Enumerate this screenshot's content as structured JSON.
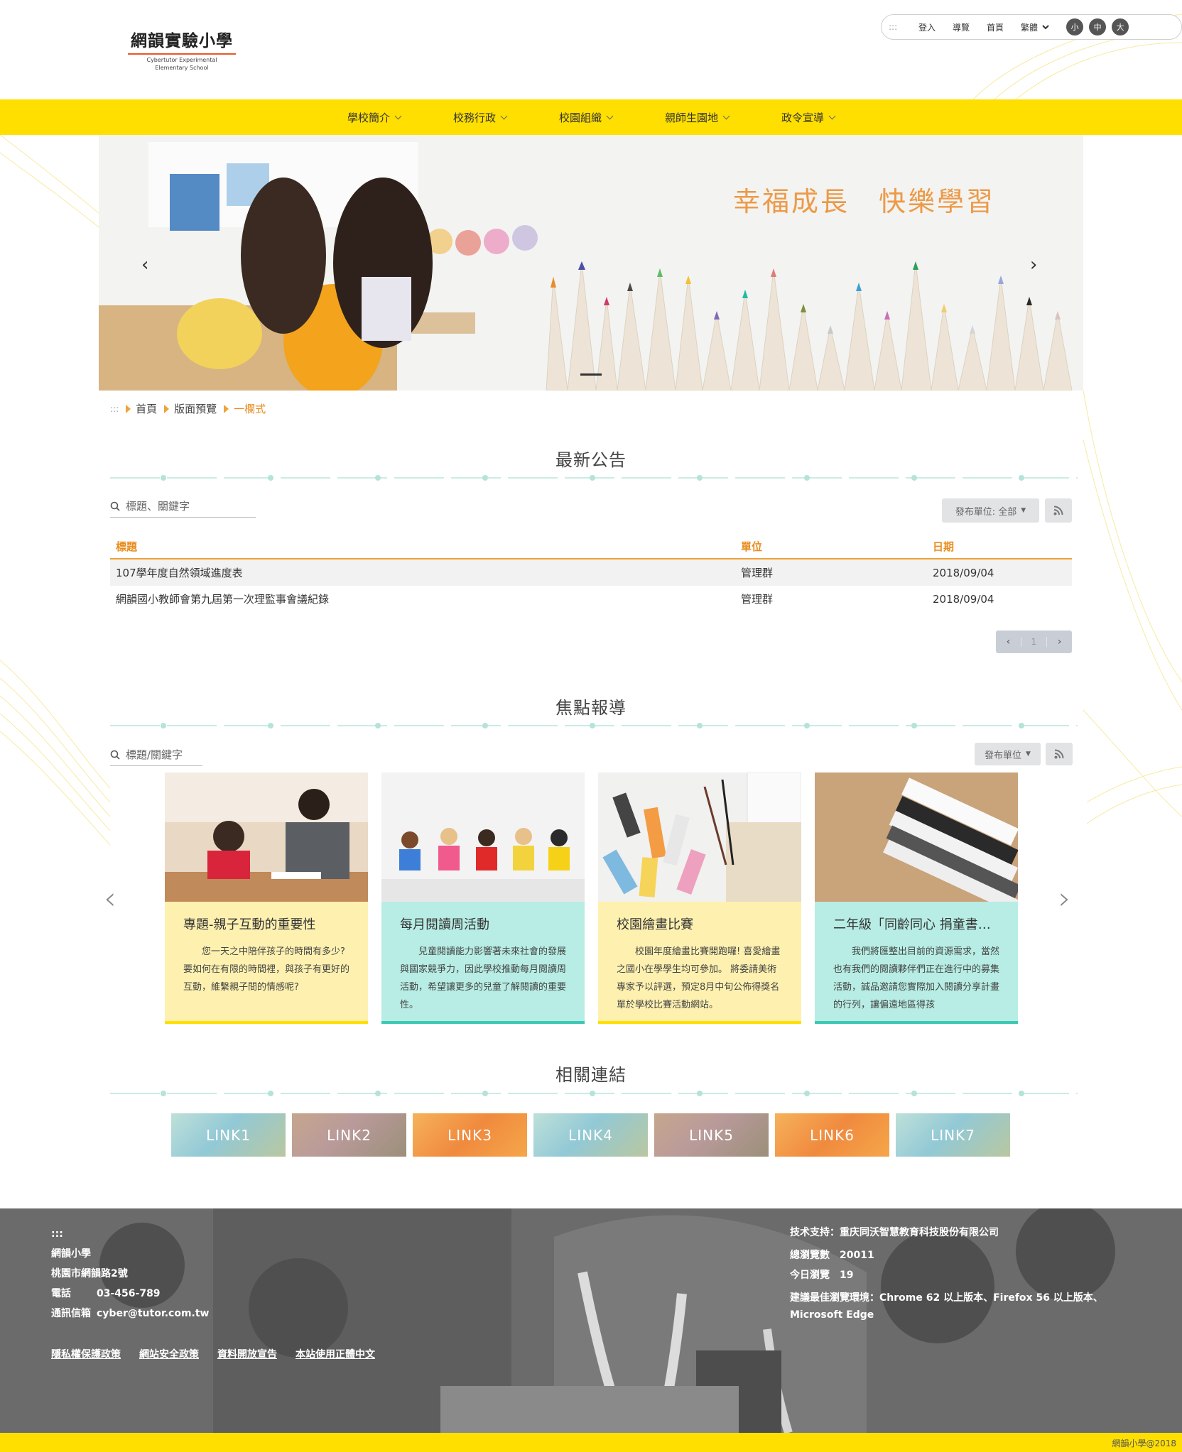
{
  "header": {
    "logo_zh": "網韻實驗小學",
    "logo_en_1": "Cybertutor Experimental",
    "logo_en_2": "Elementary School",
    "access_key": ":::",
    "login": "登入",
    "guide": "導覽",
    "home": "首頁",
    "language": "繁體",
    "font_small": "小",
    "font_medium": "中",
    "font_large": "大"
  },
  "nav": [
    "學校簡介",
    "校務行政",
    "校園組織",
    "親師生園地",
    "政令宣導"
  ],
  "banner": {
    "slogan": "幸福成長　快樂學習"
  },
  "breadcrumb": {
    "access_key": ":::",
    "home": "首頁",
    "level1": "版面預覽",
    "current": "一欄式"
  },
  "announcements": {
    "title": "最新公告",
    "search_placeholder": "標題、關鍵字",
    "unit_filter": "發布單位: 全部",
    "columns": [
      "標題",
      "單位",
      "日期"
    ],
    "rows": [
      {
        "title": "107學年度自然領域進度表",
        "unit": "管理群",
        "date": "2018/09/04"
      },
      {
        "title": "網韻國小教師會第九屆第一次理監事會議紀錄",
        "unit": "管理群",
        "date": "2018/09/04"
      }
    ],
    "page": "1"
  },
  "focus": {
    "title": "焦點報導",
    "search_placeholder": "標題/關鍵字",
    "unit_filter": "發布單位",
    "cards": [
      {
        "title": "專題-親子互動的重要性",
        "desc": "您一天之中陪伴孩子的時間有多少?要如何在有限的時間裡，與孩子有更好的互動，維繫親子間的情感呢?"
      },
      {
        "title": "每月閱讀周活動",
        "desc": "兒童閱讀能力影響著未來社會的發展與國家競爭力，因此學校推動每月閱讀周活動，希望讓更多的兒童了解閱讀的重要性。"
      },
      {
        "title": "校園繪畫比賽",
        "desc": "校園年度繪畫比賽開跑囉! 喜愛繪畫之國小在學學生均可參加。 將委請美術專家予以評選，預定8月中旬公佈得獎名單於學校比賽活動網站。"
      },
      {
        "title": "二年級「同齡同心 捐童書…",
        "desc": "我們將匯整出目前的資源需求，當然也有我們的閱讀夥伴們正在進行中的募集活動，誠品邀請您實際加入閱讀分享計畫的行列，讓偏遠地區得孩"
      }
    ]
  },
  "links": {
    "title": "相關連結",
    "items": [
      "LINK1",
      "LINK2",
      "LINK3",
      "LINK4",
      "LINK5",
      "LINK6",
      "LINK7"
    ]
  },
  "footer": {
    "access_key": ":::",
    "school": "網韻小學",
    "address": "桃園市網韻路2號",
    "phone_label": "電話",
    "phone": "03-456-789",
    "email_label": "通訊信箱",
    "email": "cyber@tutor.com.tw",
    "support": "技术支持：重庆同沃智慧教育科技股份有限公司",
    "total_views": "總瀏覽數　20011",
    "today_views": "今日瀏覽　19",
    "browser": "建議最佳瀏覽環境：Chrome 62 以上版本、Firefox 56 以上版本、Microsoft Edge",
    "policies": [
      "隱私權保護政策",
      "網站安全政策",
      "資料開放宣告",
      "本站使用正體中文"
    ],
    "copyright": "網韻小學@2018"
  },
  "colors": {
    "nav_yellow": "#ffdf00",
    "accent_orange": "#e98c1e",
    "card_yellow": "#fef1b0",
    "card_green": "#b7ede4"
  }
}
